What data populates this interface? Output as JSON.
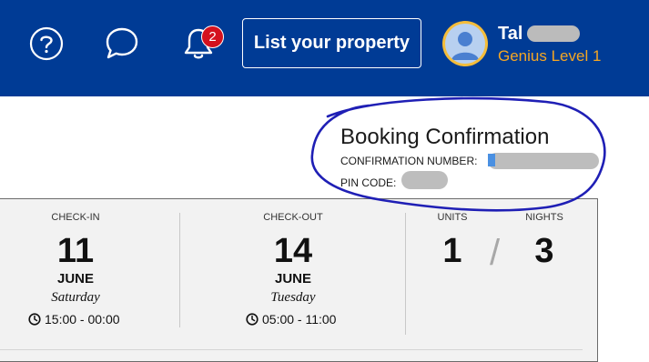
{
  "header": {
    "notification_count": "2",
    "list_property_label": "List your property",
    "user_name": "Tal",
    "user_level": "Genius Level 1"
  },
  "booking": {
    "title": "Booking Confirmation",
    "confirmation_label": "CONFIRMATION NUMBER:",
    "pin_label": "PIN CODE:"
  },
  "stay": {
    "checkin": {
      "label": "CHECK-IN",
      "day": "11",
      "month": "JUNE",
      "weekday": "Saturday",
      "time": "15:00 - 00:00"
    },
    "checkout": {
      "label": "CHECK-OUT",
      "day": "14",
      "month": "JUNE",
      "weekday": "Tuesday",
      "time": "05:00 - 11:00"
    },
    "units": {
      "label": "UNITS",
      "value": "1"
    },
    "nights": {
      "label": "NIGHTS",
      "value": "3"
    },
    "separator": "/"
  },
  "colors": {
    "brand_blue": "#003b95",
    "badge_red": "#d4111e",
    "genius_gold": "#f5a623",
    "annotation_blue": "#1f1fb5"
  },
  "icons": [
    "help-icon",
    "chat-icon",
    "bell-icon",
    "user-avatar-icon",
    "clock-icon"
  ]
}
